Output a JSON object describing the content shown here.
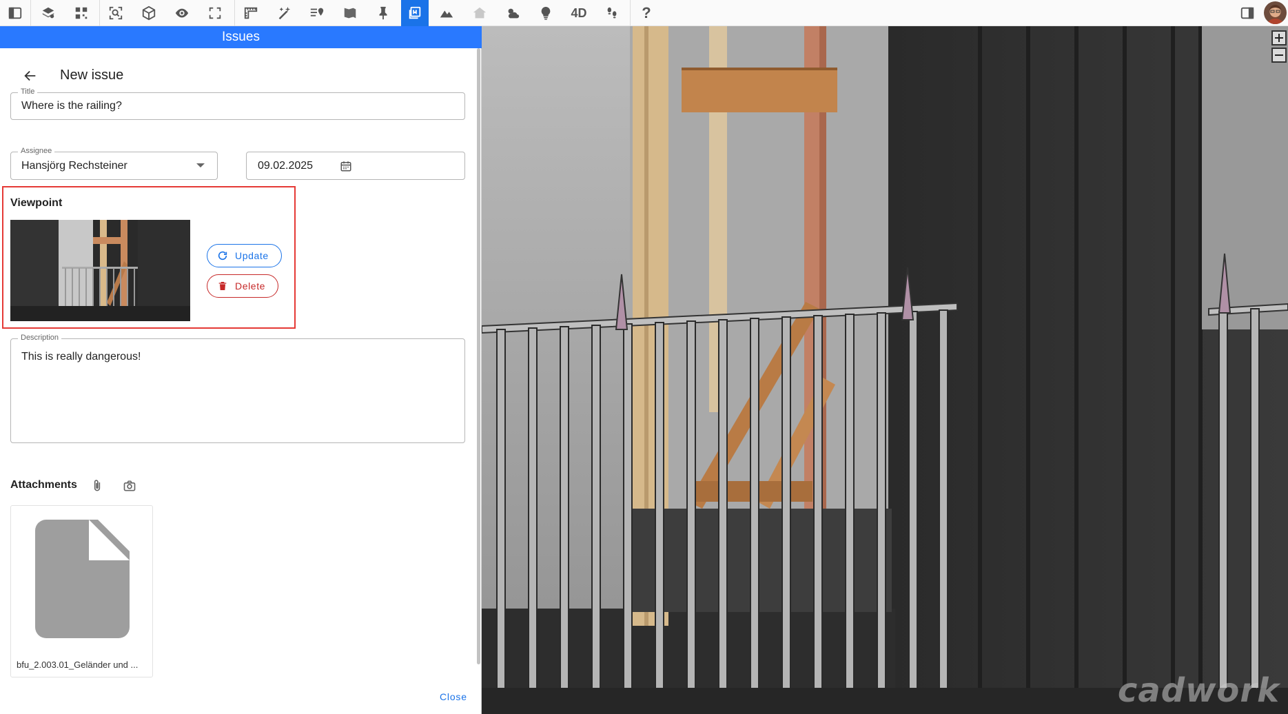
{
  "panel": {
    "header_title": "Issues",
    "heading": "New issue",
    "title_field": {
      "label": "Title",
      "value": "Where is the railing?"
    },
    "assignee_field": {
      "label": "Assignee",
      "value": "Hansjörg Rechsteiner"
    },
    "date_field": {
      "value": "09.02.2025"
    },
    "viewpoint": {
      "title": "Viewpoint",
      "update_label": "Update",
      "delete_label": "Delete"
    },
    "description_field": {
      "label": "Description",
      "value": "This is really dangerous!"
    },
    "attachments": {
      "title": "Attachments",
      "items": [
        {
          "name": "bfu_2.003.01_Geländer und ..."
        }
      ]
    },
    "close_label": "Close"
  },
  "toolbar": {
    "four_d_label": "4D",
    "help_label": "?",
    "active_tool": "issues-icon",
    "icons": [
      "sidebar-toggle-icon",
      "layers-icon",
      "qr-code-icon",
      "zoom-selection-icon",
      "cube-icon",
      "eye-icon",
      "fullscreen-icon",
      "ruler-icon",
      "magic-wand-icon",
      "location-list-icon",
      "section-box-icon",
      "pin-icon",
      "issues-icon",
      "terrain-icon",
      "home-icon",
      "weather-icon",
      "light-bulb-icon",
      "4d-label",
      "walk-icon",
      "help-icon",
      "right-panel-toggle-icon",
      "user-avatar"
    ]
  },
  "viewport": {
    "watermark": "cadwork",
    "zoom_in_icon": "plus-icon",
    "zoom_out_icon": "minus-icon"
  },
  "colors": {
    "accent": "#2979ff",
    "danger": "#c62828",
    "highlight_border": "#e53935"
  }
}
